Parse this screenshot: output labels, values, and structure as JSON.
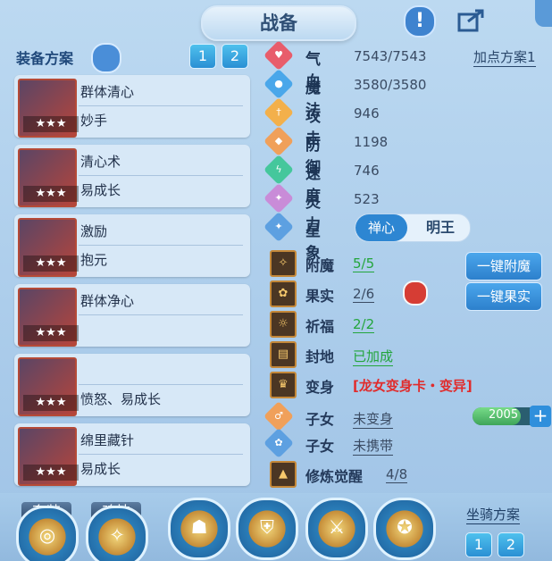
{
  "header": {
    "title": "战备"
  },
  "left": {
    "section_title": "装备方案",
    "page_buttons": [
      "1",
      "2"
    ],
    "cards": [
      {
        "name": "群体清心",
        "attr": "妙手",
        "stars": "★★★"
      },
      {
        "name": "清心术",
        "attr": "易成长",
        "stars": "★★★"
      },
      {
        "name": "激励",
        "attr": "抱元",
        "stars": "★★★"
      },
      {
        "name": "群体净心",
        "attr": "",
        "stars": "★★★"
      },
      {
        "name": "",
        "attr": "愤怒、易成长",
        "stars": "★★★"
      },
      {
        "name": "绵里藏针",
        "attr": "易成长",
        "stars": "★★★"
      }
    ]
  },
  "stats": [
    {
      "label": "气血",
      "value": "7543/7543",
      "color": "#e85d6b",
      "icon": "heart-icon",
      "glyph": "♥"
    },
    {
      "label": "魔法",
      "value": "3580/3580",
      "color": "#4aa7ea",
      "icon": "mana-icon",
      "glyph": "●"
    },
    {
      "label": "攻击",
      "value": "946",
      "color": "#f3b04b",
      "icon": "sword-icon",
      "glyph": "†"
    },
    {
      "label": "防御",
      "value": "1198",
      "color": "#f0a05a",
      "icon": "shield-icon",
      "glyph": "◆"
    },
    {
      "label": "速度",
      "value": "746",
      "color": "#45c79c",
      "icon": "lightning-icon",
      "glyph": "ϟ"
    },
    {
      "label": "灵力",
      "value": "523",
      "color": "#c98cd8",
      "icon": "magic-icon",
      "glyph": "✦"
    }
  ],
  "right": {
    "add_plan": "加点方案1",
    "star": {
      "label": "星象",
      "left": "禅心",
      "right": "明王"
    },
    "rows": [
      {
        "label": "附魔",
        "value": "5/5",
        "value_color": "#23a53c",
        "underline": true
      },
      {
        "label": "果实",
        "value": "2/6",
        "value_color": "#3a4b63",
        "underline": true
      },
      {
        "label": "祈福",
        "value": "2/2",
        "value_color": "#23a53c",
        "underline": true
      },
      {
        "label": "封地",
        "value": "已加成",
        "value_color": "#23a53c",
        "underline": true
      },
      {
        "label": "变身",
        "value": "[龙女变身卡・变异]",
        "value_color": "#e12b2b",
        "underline": false
      },
      {
        "label": "子女",
        "value": "未变身",
        "value_color": "#3a4b63",
        "underline": true
      },
      {
        "label": "子女",
        "value": "未携带",
        "value_color": "#3a4b63",
        "underline": true
      },
      {
        "label": "修炼觉醒",
        "value": "4/8",
        "value_color": "#3a4b63",
        "underline": true
      }
    ],
    "button_enchant": "一键附魔",
    "button_fruit": "一键果实",
    "power_value": "2005"
  },
  "bottom": {
    "tags": [
      "套装",
      "魂技"
    ],
    "mount_title": "坐骑方案",
    "mount_buttons": [
      "1",
      "2"
    ]
  }
}
